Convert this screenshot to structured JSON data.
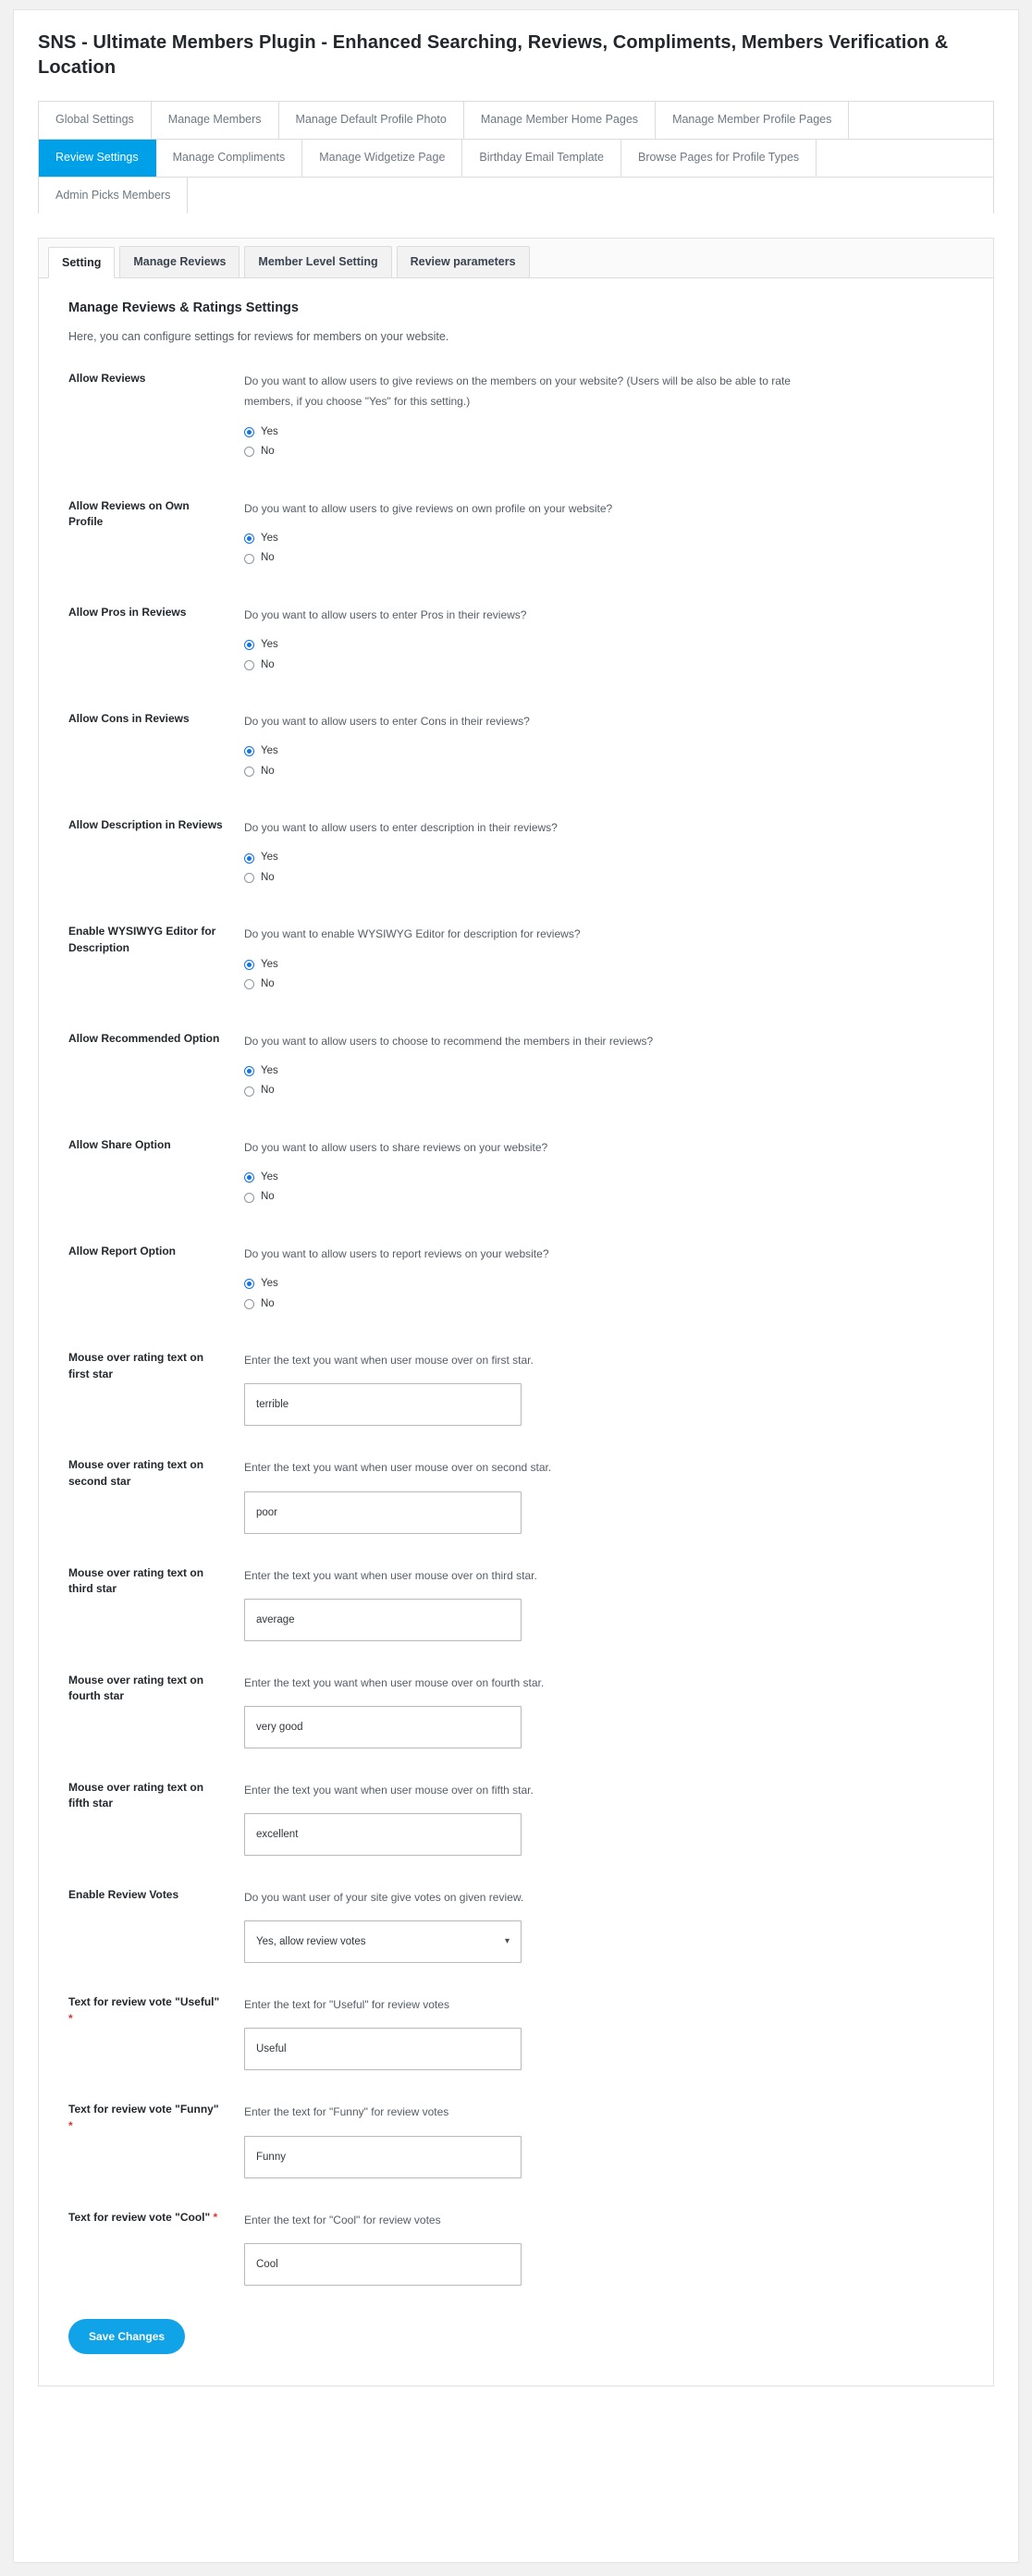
{
  "plugin": {
    "title": "SNS - Ultimate Members Plugin - Enhanced Searching, Reviews, Compliments, Members Verification & Location",
    "accent_color": "#00a0e9",
    "button_color": "#11a3e8",
    "required_color": "#dd3333"
  },
  "outer_tabs": [
    {
      "label": "Global Settings",
      "active": false
    },
    {
      "label": "Manage Members",
      "active": false
    },
    {
      "label": "Manage Default Profile Photo",
      "active": false
    },
    {
      "label": "Manage Member Home Pages",
      "active": false
    },
    {
      "label": "Manage Member Profile Pages",
      "active": false
    },
    {
      "label": "Review Settings",
      "active": true
    },
    {
      "label": "Manage Compliments",
      "active": false
    },
    {
      "label": "Manage Widgetize Page",
      "active": false
    },
    {
      "label": "Birthday Email Template",
      "active": false
    },
    {
      "label": "Browse Pages for Profile Types",
      "active": false
    },
    {
      "label": "Admin Picks Members",
      "active": false
    }
  ],
  "inner_tabs": [
    {
      "label": "Setting",
      "active": true
    },
    {
      "label": "Manage Reviews",
      "active": false
    },
    {
      "label": "Member Level Setting",
      "active": false
    },
    {
      "label": "Review parameters",
      "active": false
    }
  ],
  "panel": {
    "heading": "Manage Reviews & Ratings Settings",
    "description": "Here, you can configure settings for reviews for members on your website."
  },
  "radio_labels": {
    "yes": "Yes",
    "no": "No"
  },
  "settings": [
    {
      "label": "Allow Reviews",
      "description": "Do you want to allow users to give reviews on the members on your website? (Users will be also be able to rate members, if you choose \"Yes\" for this setting.)",
      "type": "radio",
      "selected": "Yes"
    },
    {
      "label": "Allow Reviews on Own Profile",
      "description": "Do you want to allow users to give reviews on own profile on your website?",
      "type": "radio",
      "selected": "Yes"
    },
    {
      "label": "Allow Pros in Reviews",
      "description": "Do you want to allow users to enter Pros in their reviews?",
      "type": "radio",
      "selected": "Yes"
    },
    {
      "label": "Allow Cons in Reviews",
      "description": "Do you want to allow users to enter Cons in their reviews?",
      "type": "radio",
      "selected": "Yes"
    },
    {
      "label": "Allow Description in Reviews",
      "description": "Do you want to allow users to enter description in their reviews?",
      "type": "radio",
      "selected": "Yes"
    },
    {
      "label": "Enable WYSIWYG Editor for Description",
      "description": "Do you want to enable WYSIWYG Editor for description for reviews?",
      "type": "radio",
      "selected": "Yes"
    },
    {
      "label": "Allow Recommended Option",
      "description": "Do you want to allow users to choose to recommend the members in their reviews?",
      "type": "radio",
      "selected": "Yes"
    },
    {
      "label": "Allow Share Option",
      "description": "Do you want to allow users to share reviews on your website?",
      "type": "radio",
      "selected": "Yes"
    },
    {
      "label": "Allow Report Option",
      "description": "Do you want to allow users to report reviews on your website?",
      "type": "radio",
      "selected": "Yes"
    },
    {
      "label": "Mouse over rating text on first star",
      "description": "Enter the text you want when user mouse over on first star.",
      "type": "text",
      "value": "terrible"
    },
    {
      "label": "Mouse over rating text on second star",
      "description": "Enter the text you want when user mouse over on second star.",
      "type": "text",
      "value": "poor"
    },
    {
      "label": "Mouse over rating text on third star",
      "description": "Enter the text you want when user mouse over on third star.",
      "type": "text",
      "value": "average"
    },
    {
      "label": "Mouse over rating text on fourth star",
      "description": "Enter the text you want when user mouse over on fourth star.",
      "type": "text",
      "value": "very good"
    },
    {
      "label": "Mouse over rating text on fifth star",
      "description": "Enter the text you want when user mouse over on fifth star.",
      "type": "text",
      "value": "excellent"
    },
    {
      "label": "Enable Review Votes",
      "description": "Do you want user of your site give votes on given review.",
      "type": "select",
      "value": "Yes, allow review votes",
      "caret": "chevron-down-icon"
    },
    {
      "label": "Text for review vote \"Useful\"",
      "required": true,
      "description": "Enter the text for \"Useful\" for review votes",
      "type": "text",
      "value": "Useful"
    },
    {
      "label": "Text for review vote \"Funny\"",
      "required": true,
      "description": "Enter the text for \"Funny\" for review votes",
      "type": "text",
      "value": "Funny"
    },
    {
      "label": "Text for review vote \"Cool\"",
      "required": true,
      "description": "Enter the text for \"Cool\" for review votes",
      "type": "text",
      "value": "Cool"
    }
  ],
  "save_button": {
    "label": "Save Changes"
  }
}
